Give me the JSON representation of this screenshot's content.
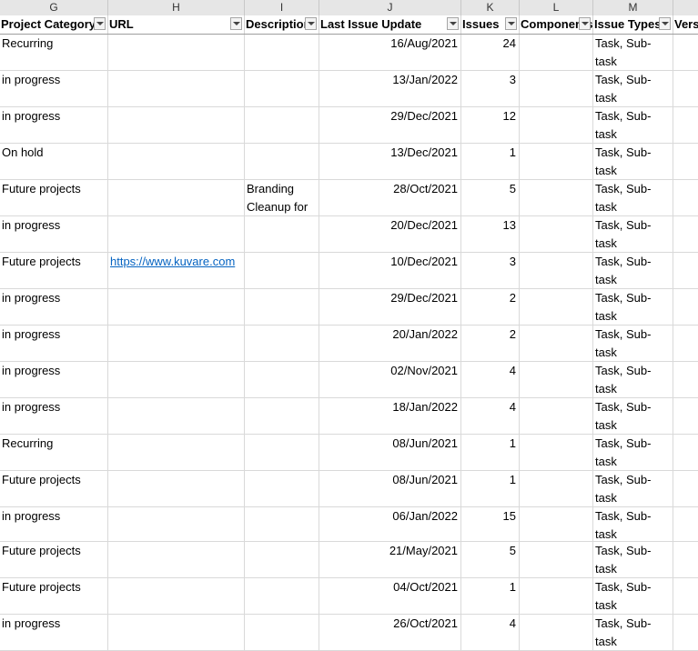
{
  "column_letters": [
    "G",
    "H",
    "I",
    "J",
    "K",
    "L",
    "M",
    ""
  ],
  "headers": [
    "Project Category",
    "URL",
    "Description",
    "Last Issue Update",
    "Issues",
    "Components",
    "Issue Types",
    "Versions"
  ],
  "rows": [
    {
      "category": "Recurring",
      "url": "",
      "description": "",
      "last_update": "16/Aug/2021",
      "issues": "24",
      "components": "",
      "issue_types": "Task, Sub-task",
      "versions": ""
    },
    {
      "category": "in progress",
      "url": "",
      "description": "",
      "last_update": "13/Jan/2022",
      "issues": "3",
      "components": "",
      "issue_types": "Task, Sub-task",
      "versions": ""
    },
    {
      "category": "in progress",
      "url": "",
      "description": "",
      "last_update": "29/Dec/2021",
      "issues": "12",
      "components": "",
      "issue_types": "Task, Sub-task",
      "versions": ""
    },
    {
      "category": "On hold",
      "url": "",
      "description": "",
      "last_update": "13/Dec/2021",
      "issues": "1",
      "components": "",
      "issue_types": "Task, Sub-task",
      "versions": ""
    },
    {
      "category": "Future projects",
      "url": "",
      "description": "Branding Cleanup for",
      "last_update": "28/Oct/2021",
      "issues": "5",
      "components": "",
      "issue_types": "Task, Sub-task",
      "versions": ""
    },
    {
      "category": "in progress",
      "url": "",
      "description": "",
      "last_update": "20/Dec/2021",
      "issues": "13",
      "components": "",
      "issue_types": "Task, Sub-task",
      "versions": ""
    },
    {
      "category": "Future projects",
      "url": "https://www.kuvare.com",
      "description": "",
      "last_update": "10/Dec/2021",
      "issues": "3",
      "components": "",
      "issue_types": "Task, Sub-task",
      "versions": ""
    },
    {
      "category": "in progress",
      "url": "",
      "description": "",
      "last_update": "29/Dec/2021",
      "issues": "2",
      "components": "",
      "issue_types": "Task, Sub-task",
      "versions": ""
    },
    {
      "category": "in progress",
      "url": "",
      "description": "",
      "last_update": "20/Jan/2022",
      "issues": "2",
      "components": "",
      "issue_types": "Task, Sub-task",
      "versions": ""
    },
    {
      "category": "in progress",
      "url": "",
      "description": "",
      "last_update": "02/Nov/2021",
      "issues": "4",
      "components": "",
      "issue_types": "Task, Sub-task",
      "versions": ""
    },
    {
      "category": "in progress",
      "url": "",
      "description": "",
      "last_update": "18/Jan/2022",
      "issues": "4",
      "components": "",
      "issue_types": "Task, Sub-task",
      "versions": ""
    },
    {
      "category": "Recurring",
      "url": "",
      "description": "",
      "last_update": "08/Jun/2021",
      "issues": "1",
      "components": "",
      "issue_types": "Task, Sub-task",
      "versions": ""
    },
    {
      "category": "Future projects",
      "url": "",
      "description": "",
      "last_update": "08/Jun/2021",
      "issues": "1",
      "components": "",
      "issue_types": "Task, Sub-task",
      "versions": ""
    },
    {
      "category": "in progress",
      "url": "",
      "description": "",
      "last_update": "06/Jan/2022",
      "issues": "15",
      "components": "",
      "issue_types": "Task, Sub-task",
      "versions": ""
    },
    {
      "category": "Future projects",
      "url": "",
      "description": "",
      "last_update": "21/May/2021",
      "issues": "5",
      "components": "",
      "issue_types": "Task, Sub-task",
      "versions": ""
    },
    {
      "category": "Future projects",
      "url": "",
      "description": "",
      "last_update": "04/Oct/2021",
      "issues": "1",
      "components": "",
      "issue_types": "Task, Sub-task",
      "versions": ""
    },
    {
      "category": "in progress",
      "url": "",
      "description": "",
      "last_update": "26/Oct/2021",
      "issues": "4",
      "components": "",
      "issue_types": "Task, Sub-task",
      "versions": ""
    }
  ],
  "colors": {
    "header_bg": "#e6e6e6",
    "grid": "#d9d9d9",
    "link": "#0563c1"
  }
}
